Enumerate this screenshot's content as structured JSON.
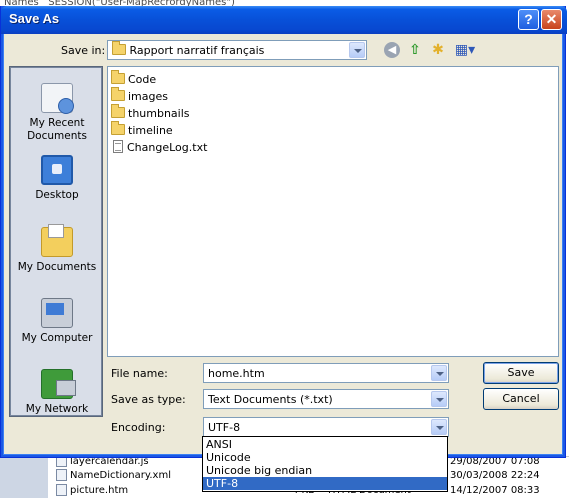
{
  "background": {
    "top_text": "Names   SESSION(\"User-MapRecrordyNames\")",
    "rows": [
      {
        "name": "layercalendar.js",
        "size": "",
        "type": "",
        "date": "29/08/2007 07:08"
      },
      {
        "name": "NameDictionary.xml",
        "size": "",
        "type": "",
        "date": "30/03/2008 22:24"
      },
      {
        "name": "picture.htm",
        "size": "4 KB",
        "type": "HTML Document",
        "date": "14/12/2007 08:33"
      }
    ]
  },
  "dialog": {
    "title": "Save As",
    "help_label": "?",
    "close_label": "✕"
  },
  "toolbar": {
    "save_in_label": "Save in:",
    "save_in_value": "Rapport narratif français",
    "back_icon": "back-icon",
    "up_icon": "up-one-level-icon",
    "new_folder_icon": "new-folder-icon",
    "views_icon": "views-menu-icon",
    "back_glyph": "◀",
    "up_glyph": "⇧",
    "new_folder_glyph": "✱",
    "views_glyph": "▦▾"
  },
  "places": [
    {
      "label": "My Recent Documents",
      "icon": "recent-documents-icon"
    },
    {
      "label": "Desktop",
      "icon": "desktop-icon"
    },
    {
      "label": "My Documents",
      "icon": "my-documents-icon"
    },
    {
      "label": "My Computer",
      "icon": "my-computer-icon"
    },
    {
      "label": "My Network",
      "icon": "my-network-icon"
    }
  ],
  "files": [
    {
      "name": "Code",
      "kind": "folder"
    },
    {
      "name": "images",
      "kind": "folder"
    },
    {
      "name": "thumbnails",
      "kind": "folder"
    },
    {
      "name": "timeline",
      "kind": "folder"
    },
    {
      "name": "ChangeLog.txt",
      "kind": "text"
    }
  ],
  "fields": {
    "file_name_label": "File name:",
    "file_name_value": "home.htm",
    "save_as_type_label": "Save as type:",
    "save_as_type_value": "Text Documents (*.txt)",
    "encoding_label": "Encoding:",
    "encoding_value": "UTF-8"
  },
  "buttons": {
    "save": "Save",
    "cancel": "Cancel"
  },
  "encoding_options": [
    {
      "label": "ANSI",
      "selected": false
    },
    {
      "label": "Unicode",
      "selected": false
    },
    {
      "label": "Unicode big endian",
      "selected": false
    },
    {
      "label": "UTF-8",
      "selected": true
    }
  ],
  "colors": {
    "titlebar": "#0850d8",
    "dialog_face": "#ece9d8",
    "selection": "#316ac5"
  }
}
